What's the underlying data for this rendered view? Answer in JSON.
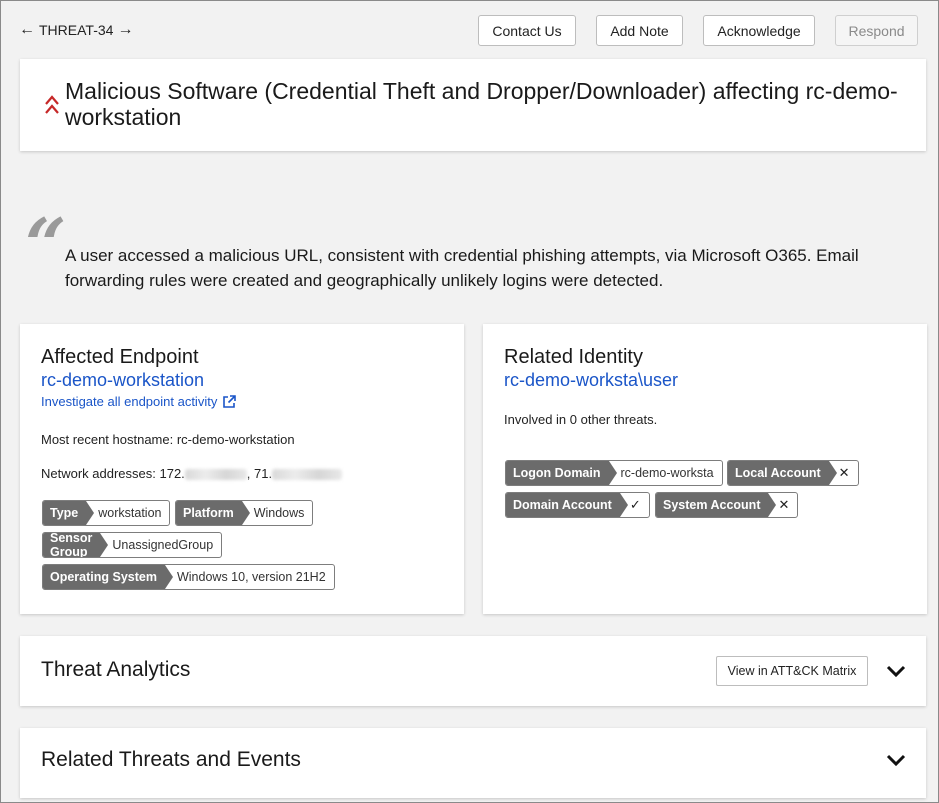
{
  "header": {
    "threat_id": "THREAT-34",
    "prev_arrow": "🡐",
    "next_arrow": "🡒",
    "buttons": {
      "contact": "Contact Us",
      "note": "Add Note",
      "acknowledge": "Acknowledge",
      "respond": "Respond"
    }
  },
  "threat": {
    "title": "Malicious Software (Credential Theft and Dropper/Downloader) affecting rc-demo-workstation",
    "severity_icon": "double-chevron-up-icon",
    "severity_color": "#c62828",
    "summary": "A user accessed a malicious URL, consistent with credential phishing attempts, via Microsoft O365. Email forwarding rules were created and geographically unlikely logins were detected."
  },
  "endpoint": {
    "heading": "Affected Endpoint",
    "name": "rc-demo-workstation",
    "investigate_link": "Investigate all endpoint activity",
    "hostname_label": "Most recent hostname: rc-demo-workstation",
    "network_label": "Network addresses: 172.",
    "network_sep": ", 71.",
    "tags": [
      {
        "key": "Type",
        "value": "workstation"
      },
      {
        "key": "Platform",
        "value": "Windows"
      },
      {
        "key": "Sensor Group",
        "value": "UnassignedGroup"
      },
      {
        "key": "Operating System",
        "value": "Windows 10, version 21H2"
      }
    ]
  },
  "identity": {
    "heading": "Related Identity",
    "name": "rc-demo-worksta\\user",
    "involved": "Involved in 0 other threats.",
    "tags": [
      {
        "key": "Logon Domain",
        "value": "rc-demo-worksta"
      },
      {
        "key": "Local Account",
        "value": "✕"
      },
      {
        "key": "Domain Account",
        "value": "✓"
      },
      {
        "key": "System Account",
        "value": "✕"
      }
    ]
  },
  "sections": {
    "analytics_title": "Threat Analytics",
    "matrix_button": "View in ATT&CK Matrix",
    "related_title": "Related Threats and Events"
  },
  "colors": {
    "link": "#1a55c8",
    "tag_key_bg": "#6b6b6b",
    "severity": "#c62828"
  }
}
